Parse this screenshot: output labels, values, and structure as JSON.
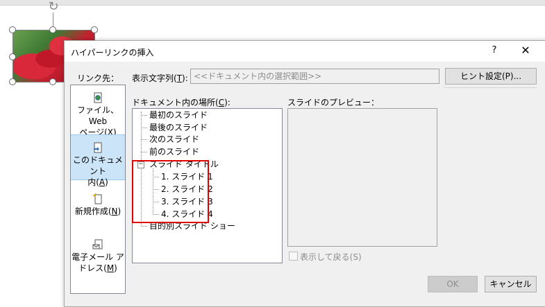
{
  "dialog": {
    "title": "ハイパーリンクの挿入",
    "help": "?",
    "close": "✕"
  },
  "link_to": {
    "label": "リンク先：",
    "items": [
      {
        "line1": "ファイル、Web",
        "line2": "ページ(",
        "key": "X",
        "tail": ")",
        "icon": "web-page-icon"
      },
      {
        "line1": "このドキュメント",
        "line2": "内(",
        "key": "A",
        "tail": ")",
        "icon": "document-icon",
        "selected": true
      },
      {
        "line1": "",
        "line2": "新規作成(",
        "key": "N",
        "tail": ")",
        "icon": "new-document-icon"
      },
      {
        "line1": "電子メール ア",
        "line2": "ドレス(",
        "key": "M",
        "tail": ")",
        "icon": "email-icon"
      }
    ]
  },
  "display_text": {
    "label_pre": "表示文字列(",
    "label_key": "T",
    "label_post": "):",
    "value": "<<ドキュメント内の選択範囲>>"
  },
  "screen_tip_button": "ヒント設定(P)...",
  "location": {
    "label_pre": "ドキュメント内の場所(",
    "label_key": "C",
    "label_post": "):",
    "items": {
      "first": "最初のスライド",
      "last": "最後のスライド",
      "next": "次のスライド",
      "prev": "前のスライド",
      "titles": "スライド タイトル",
      "s1": "1. スライド 1",
      "s2": "2. スライド 2",
      "s3": "3. スライド 3",
      "s4": "4. スライド 4",
      "custom": "目的別スライド ショー"
    },
    "expander": "−"
  },
  "preview": {
    "label": "スライドのプレビュー：",
    "show_and_return": "表示して戻る(S)"
  },
  "buttons": {
    "ok": "OK",
    "cancel": "キャンセル"
  },
  "icons": {
    "rotate": "↻"
  }
}
